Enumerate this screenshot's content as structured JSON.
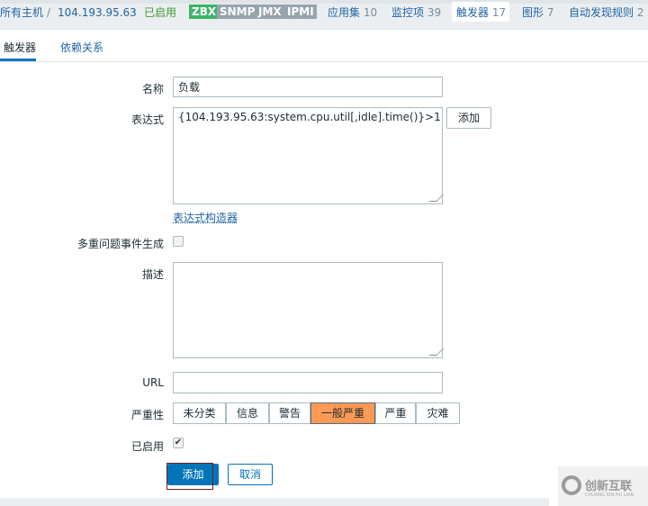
{
  "breadcrumb": {
    "all_hosts": "所有主机",
    "separator": "/",
    "host": "104.193.95.63",
    "status": "已启用",
    "tags": [
      {
        "label": "ZBX",
        "color": "#3db46a"
      },
      {
        "label": "SNMP",
        "color": "#97a4ab"
      },
      {
        "label": "JMX",
        "color": "#97a4ab"
      },
      {
        "label": "IPMI",
        "color": "#97a4ab"
      }
    ],
    "links": [
      {
        "label": "应用集",
        "count": "10"
      },
      {
        "label": "监控项",
        "count": "39"
      },
      {
        "label": "触发器",
        "count": "17"
      },
      {
        "label": "图形",
        "count": "7"
      },
      {
        "label": "自动发现规则",
        "count": "2"
      }
    ]
  },
  "tabs": [
    {
      "label": "触发器",
      "active": true
    },
    {
      "label": "依赖关系",
      "active": false
    }
  ],
  "form": {
    "name_label": "名称",
    "name_value": "负载",
    "expression_label": "表达式",
    "expression_value": "{104.193.95.63:system.cpu.util[,idle].time()}>1",
    "expression_add": "添加",
    "constructor_link": "表达式构造器",
    "multiple_label": "多重问题事件生成",
    "multiple_checked": false,
    "description_label": "描述",
    "description_value": "",
    "url_label": "URL",
    "url_value": "",
    "severity_label": "严重性",
    "severities": [
      "未分类",
      "信息",
      "警告",
      "一般严重",
      "严重",
      "灾难"
    ],
    "severity_selected": "一般严重",
    "severity_color": "#ff9955",
    "enabled_label": "已启用",
    "enabled_checked": true,
    "add_button": "添加",
    "cancel_button": "取消"
  },
  "watermark": {
    "text": "创新互联",
    "sub": "CHUANG XIN HU LIAN"
  }
}
